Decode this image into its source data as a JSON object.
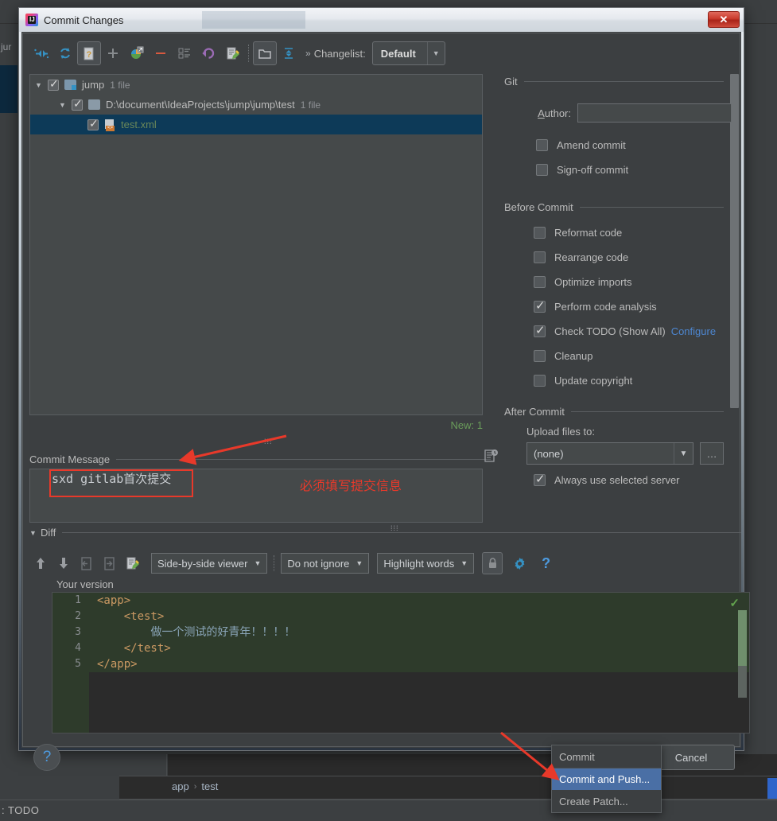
{
  "background": {
    "left_tool_label": "jur",
    "breadcrumbs": [
      "app",
      "test"
    ],
    "status_bar_text": ": TODO"
  },
  "dialog": {
    "title": "Commit Changes",
    "close_label": "✕",
    "toolbar": {
      "icons": [
        "collapse-arrows-icon",
        "refresh-icon",
        "show-diff-icon",
        "add-icon",
        "move-to-changelist-icon",
        "delete-icon",
        "select-list-icon",
        "rollback-icon",
        "edit-source-icon",
        "group-by-directory-icon",
        "expand-collapse-icon"
      ],
      "more_label": "»",
      "changelist_label": "Changelist:",
      "changelist_value": "Default"
    },
    "tree": {
      "nodes": [
        {
          "level": 1,
          "label": "jump",
          "count": "1 file",
          "checked": true,
          "expanded": true,
          "selected": false,
          "icon": "module-folder-icon"
        },
        {
          "level": 2,
          "label": "D:\\document\\IdeaProjects\\jump\\jump\\test",
          "count": "1 file",
          "checked": true,
          "expanded": true,
          "selected": false,
          "icon": "folder-icon"
        },
        {
          "level": 3,
          "label": "test.xml",
          "count": "",
          "checked": true,
          "expanded": null,
          "selected": true,
          "icon": "xml-file-icon"
        }
      ],
      "new_count_label": "New: 1"
    },
    "commit_message": {
      "section_label": "Commit Message",
      "value": "sxd gitlab首次提交",
      "history_icon": "message-history-icon"
    },
    "annotation_commit": "必须填写提交信息",
    "git_section": {
      "title": "Git",
      "author_label": "Author:",
      "author_value": "",
      "checkboxes": [
        {
          "label": "Amend commit",
          "checked": false,
          "mnemonic": "m"
        },
        {
          "label": "Sign-off commit",
          "checked": false,
          "mnemonic": "g"
        }
      ]
    },
    "before_commit": {
      "title": "Before Commit",
      "checkboxes": [
        {
          "label": "Reformat code",
          "checked": false
        },
        {
          "label": "Rearrange code",
          "checked": false
        },
        {
          "label": "Optimize imports",
          "checked": false
        },
        {
          "label": "Perform code analysis",
          "checked": true
        },
        {
          "label": "Check TODO (Show All)",
          "checked": true,
          "link": "Configure"
        },
        {
          "label": "Cleanup",
          "checked": false
        },
        {
          "label": "Update copyright",
          "checked": false
        }
      ]
    },
    "after_commit": {
      "title": "After Commit",
      "upload_label": "Upload files to:",
      "upload_value": "(none)",
      "browse_label": "…",
      "always_use_label": "Always use selected server",
      "always_use_checked": true
    },
    "diff": {
      "title": "Diff",
      "toolbar_icons": [
        "prev-difference-icon",
        "next-difference-icon",
        "accept-left-icon",
        "accept-right-icon",
        "edit-source-icon"
      ],
      "viewer_mode": "Side-by-side viewer",
      "ignore_mode": "Do not ignore",
      "highlight_mode": "Highlight words",
      "lock_icon": "lock-icon",
      "settings_icon": "gear-icon",
      "help_icon": "help-icon",
      "version_label": "Your version",
      "lines": [
        {
          "no": "1",
          "text": "<app>",
          "cn": ""
        },
        {
          "no": "2",
          "text": "    <test>",
          "cn": ""
        },
        {
          "no": "3",
          "text": "        ",
          "cn": "做一个测试的好青年！！！！"
        },
        {
          "no": "4",
          "text": "    </test>",
          "cn": ""
        },
        {
          "no": "5",
          "text": "</app>",
          "cn": ""
        }
      ]
    },
    "footer": {
      "help_label": "?",
      "commit_label": "Commit",
      "commit_arrow": "▾",
      "cancel_label": "Cancel",
      "menu_items": [
        {
          "label": "Commit",
          "highlighted": false
        },
        {
          "label": "Commit and Push...",
          "highlighted": true
        },
        {
          "label": "Create Patch...",
          "highlighted": false
        }
      ]
    }
  },
  "colors": {
    "accent_blue": "#4d86d0",
    "annotation_red": "#e8392a",
    "new_green": "#6a9c5a",
    "dialog_bg": "#3c3f41"
  }
}
